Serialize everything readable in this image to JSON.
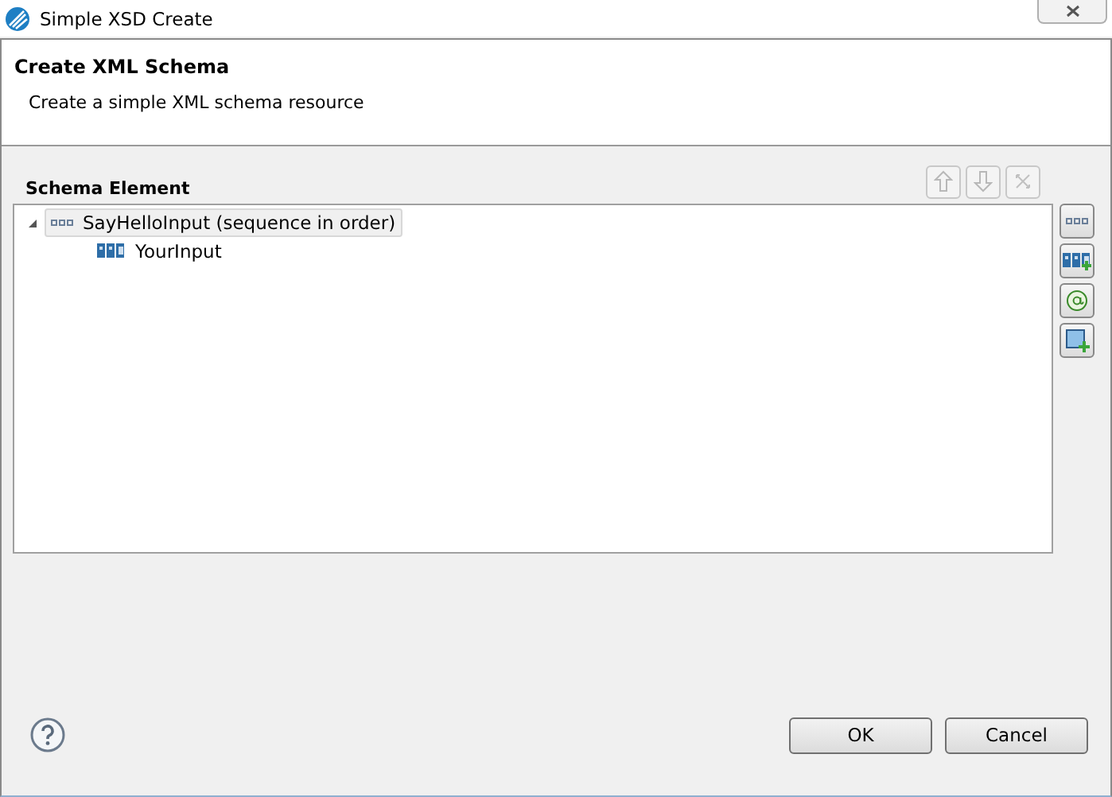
{
  "window": {
    "title": "Simple XSD Create"
  },
  "header": {
    "title": "Create XML Schema",
    "description": "Create a simple XML schema resource"
  },
  "section": {
    "title": "Schema Element"
  },
  "toolbar": [
    {
      "kind": "up",
      "disabled": true
    },
    {
      "kind": "down",
      "disabled": true
    },
    {
      "kind": "delete",
      "disabled": true
    }
  ],
  "tree": [
    {
      "kind": "sequence",
      "label": "SayHelloInput  (sequence in order)",
      "selected": true,
      "expanded": true,
      "children": [
        {
          "kind": "text",
          "label": "YourInput",
          "selected": false
        }
      ]
    }
  ],
  "side_buttons": [
    {
      "kind": "sequence"
    },
    {
      "kind": "add-text"
    },
    {
      "kind": "attribute"
    },
    {
      "kind": "add-complex"
    }
  ],
  "buttons": [
    {
      "label": "OK"
    },
    {
      "label": "Cancel"
    }
  ]
}
